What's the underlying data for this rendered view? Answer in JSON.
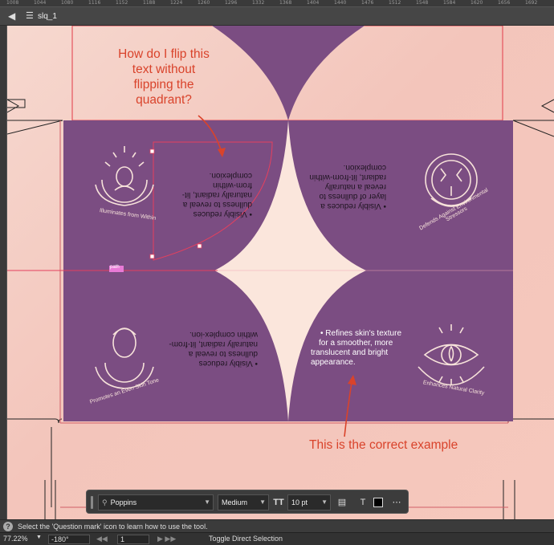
{
  "ruler_top": [
    "1008",
    "1044",
    "1080",
    "1116",
    "1152",
    "1188",
    "1224",
    "1260",
    "1296",
    "1332",
    "1368",
    "1404",
    "1440",
    "1476",
    "1512",
    "1548",
    "1584",
    "1620",
    "1656",
    "1692"
  ],
  "document": {
    "tab_title": "slq_1"
  },
  "panels": {
    "top_left": {
      "caption": "Illuminates from Within",
      "bullet": "• Visibly reduces dullness to reveal a naturally radiant, lit-from-within complexion."
    },
    "top_right": {
      "caption": "Defends Against Environmental Stressors",
      "bullet": "• Visibly reduces a layer of dullness to reveal a naturally radiant, lit-from-within complexion."
    },
    "bottom_left": {
      "caption": "Promotes an Even Skin Tone",
      "bullet": "• Visibly reduces dullness to reveal a naturally radiant, lit-from-within complex-ion."
    },
    "bottom_right": {
      "caption": "Enhances Natural Clarity",
      "bullet_lines": [
        "• Refines skin's texture",
        "for a smoother, more",
        "translucent and bright",
        "appearance."
      ]
    }
  },
  "path_label": "path",
  "annotations": {
    "question_lines": [
      "How do I flip this",
      "text without",
      "flipping the",
      "quadrant?"
    ],
    "correct": "This is the correct example"
  },
  "text_toolbar": {
    "font_family": "Poppins",
    "font_weight": "Medium",
    "font_size": "10 pt",
    "fill_color": "#000000"
  },
  "status": {
    "help_text": "Select the 'Question mark' icon to learn how to use the tool."
  },
  "bottom_bar": {
    "zoom": "77.22%",
    "rotation": "-180°",
    "artboard": "1",
    "toggle": "Toggle Direct Selection"
  },
  "colors": {
    "purple": "#7b4d82",
    "cream": "#fbe6dc",
    "icon_line": "#f7e2da",
    "annotation": "#d9432b",
    "guide": "#e4405e"
  }
}
